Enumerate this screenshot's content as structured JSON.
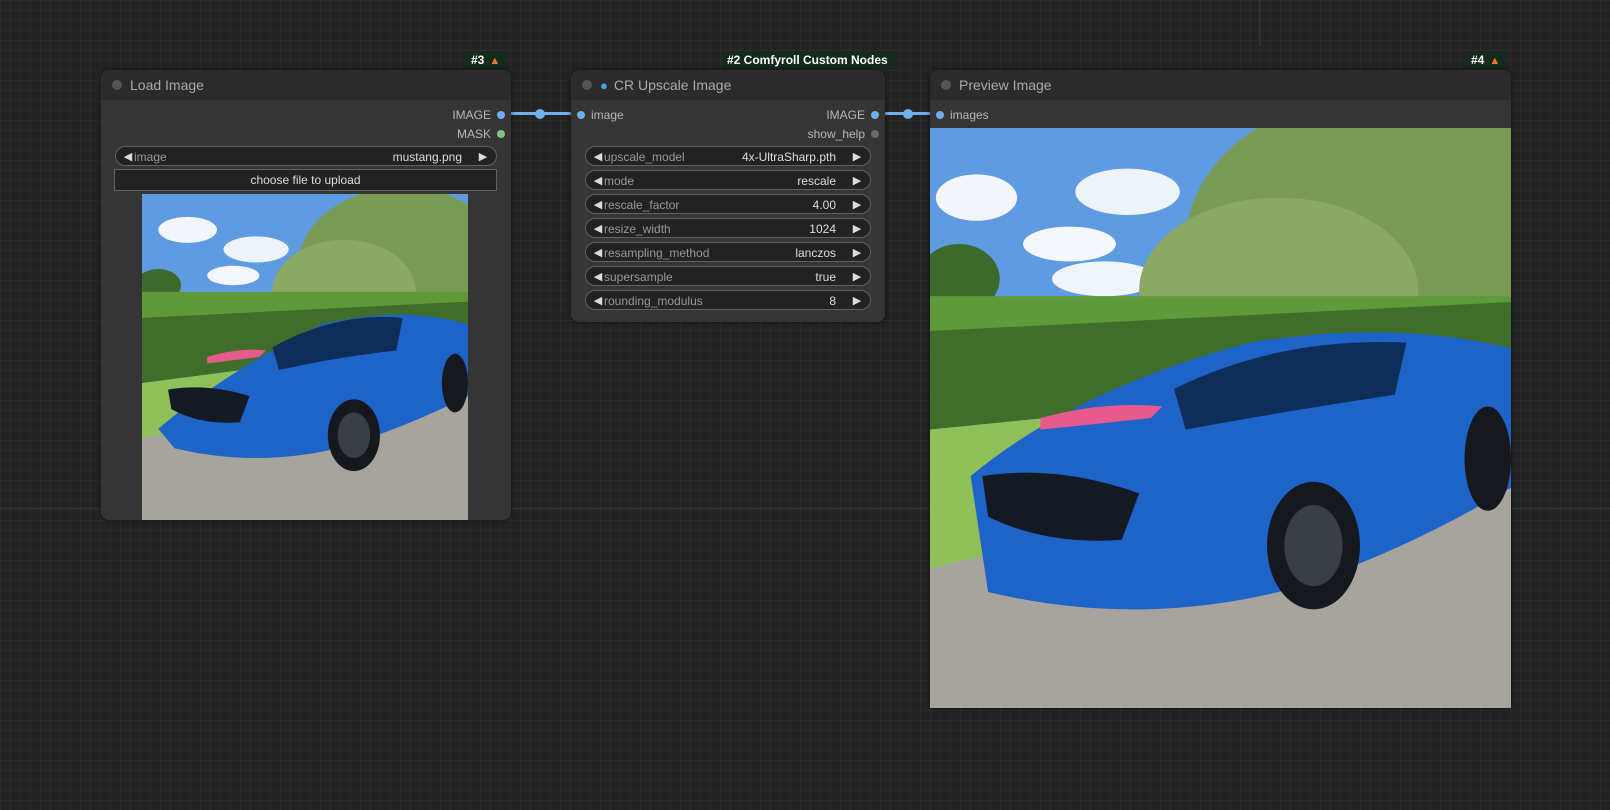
{
  "load_node": {
    "badge": "#3",
    "title": "Load Image",
    "outputs": [
      "IMAGE",
      "MASK"
    ],
    "image_widget": {
      "label": "image",
      "value": "mustang.png"
    },
    "upload_label": "choose file to upload"
  },
  "upscale_node": {
    "badge": "#2 Comfyroll Custom Nodes",
    "title": "CR Upscale Image",
    "input": "image",
    "outputs": [
      "IMAGE",
      "show_help"
    ],
    "widgets": [
      {
        "label": "upscale_model",
        "value": "4x-UltraSharp.pth"
      },
      {
        "label": "mode",
        "value": "rescale"
      },
      {
        "label": "rescale_factor",
        "value": "4.00"
      },
      {
        "label": "resize_width",
        "value": "1024"
      },
      {
        "label": "resampling_method",
        "value": "lanczos"
      },
      {
        "label": "supersample",
        "value": "true"
      },
      {
        "label": "rounding_modulus",
        "value": "8"
      }
    ]
  },
  "preview_node": {
    "badge": "#4",
    "title": "Preview Image",
    "input": "images"
  },
  "colors": {
    "wire": "#6fb0ec",
    "image_port": "#6fb0ec",
    "mask_port": "#7fc27f",
    "node_bg": "#353535",
    "canvas_bg": "#222222"
  },
  "icons": [
    "fox-icon",
    "magnifier-icon",
    "arrow-left-icon",
    "arrow-right-icon"
  ]
}
